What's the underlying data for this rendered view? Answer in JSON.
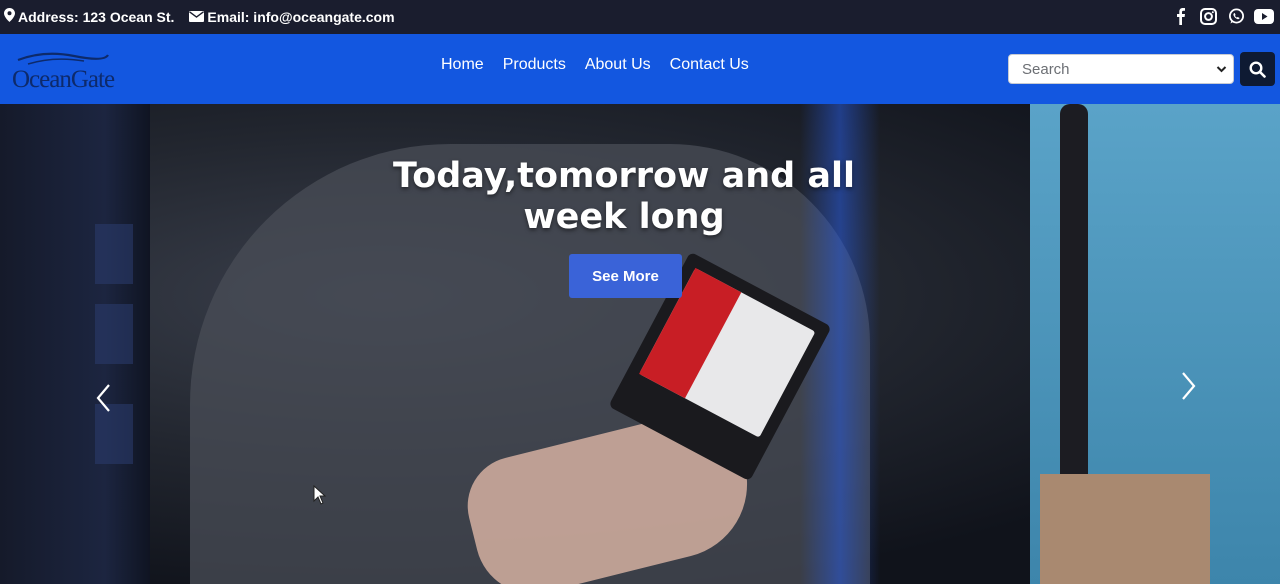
{
  "topbar": {
    "address": "Address: 123 Ocean St.",
    "email": "Email: info@oceangate.com",
    "social": [
      "facebook-icon",
      "instagram-icon",
      "whatsapp-icon",
      "youtube-icon"
    ]
  },
  "navbar": {
    "logo_text": "OceanGate",
    "links": [
      "Home",
      "Products",
      "About Us",
      "Contact Us"
    ],
    "search_placeholder": "Search"
  },
  "hero": {
    "heading": "Today,tomorrow and all week long",
    "cta_label": "See More"
  },
  "colors": {
    "topbar_bg": "#1a1d2e",
    "navbar_bg": "#1357e0",
    "cta_bg": "#3a63d8",
    "search_button_bg": "#0e1a33"
  }
}
